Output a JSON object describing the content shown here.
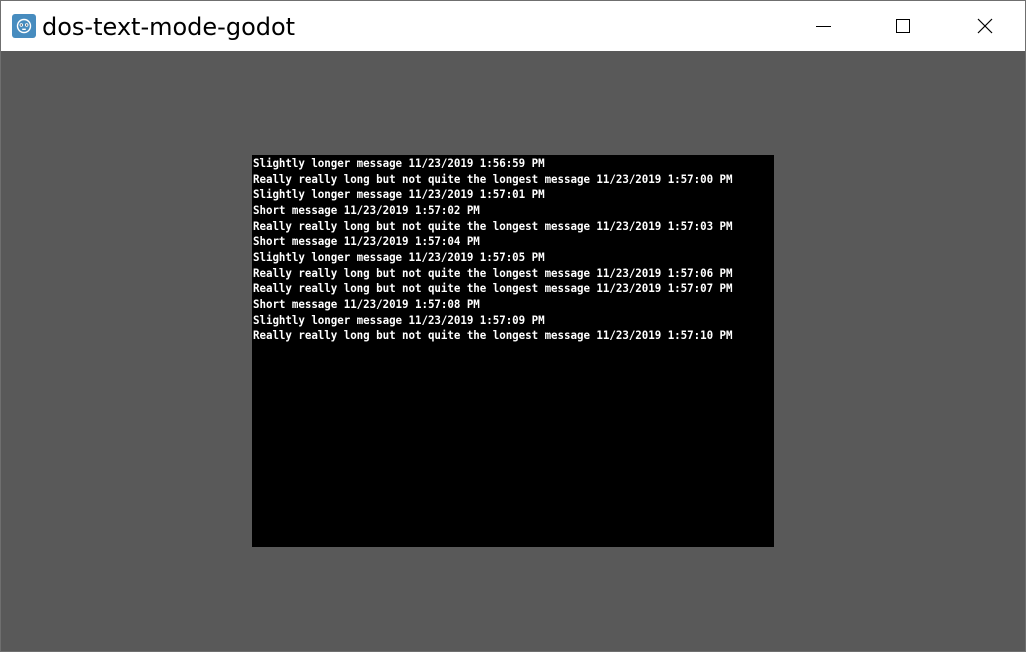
{
  "window": {
    "title": "dos-text-mode-godot",
    "app_icon": "godot-icon",
    "controls": {
      "minimize_icon": "minimize-icon",
      "maximize_icon": "maximize-icon",
      "close_icon": "close-icon"
    }
  },
  "console": {
    "background": "#000000",
    "text_color": "#ffffff",
    "lines": [
      "Slightly longer message 11/23/2019 1:56:59 PM",
      "Really really long but not quite the longest message 11/23/2019 1:57:00 PM",
      "Slightly longer message 11/23/2019 1:57:01 PM",
      "Short message 11/23/2019 1:57:02 PM",
      "Really really long but not quite the longest message 11/23/2019 1:57:03 PM",
      "Short message 11/23/2019 1:57:04 PM",
      "Slightly longer message 11/23/2019 1:57:05 PM",
      "Really really long but not quite the longest message 11/23/2019 1:57:06 PM",
      "Really really long but not quite the longest message 11/23/2019 1:57:07 PM",
      "Short message 11/23/2019 1:57:08 PM",
      "Slightly longer message 11/23/2019 1:57:09 PM",
      "Really really long but not quite the longest message 11/23/2019 1:57:10 PM"
    ]
  },
  "colors": {
    "window_background": "#595959",
    "titlebar_background": "#ffffff",
    "icon_blue": "#478cbf"
  }
}
